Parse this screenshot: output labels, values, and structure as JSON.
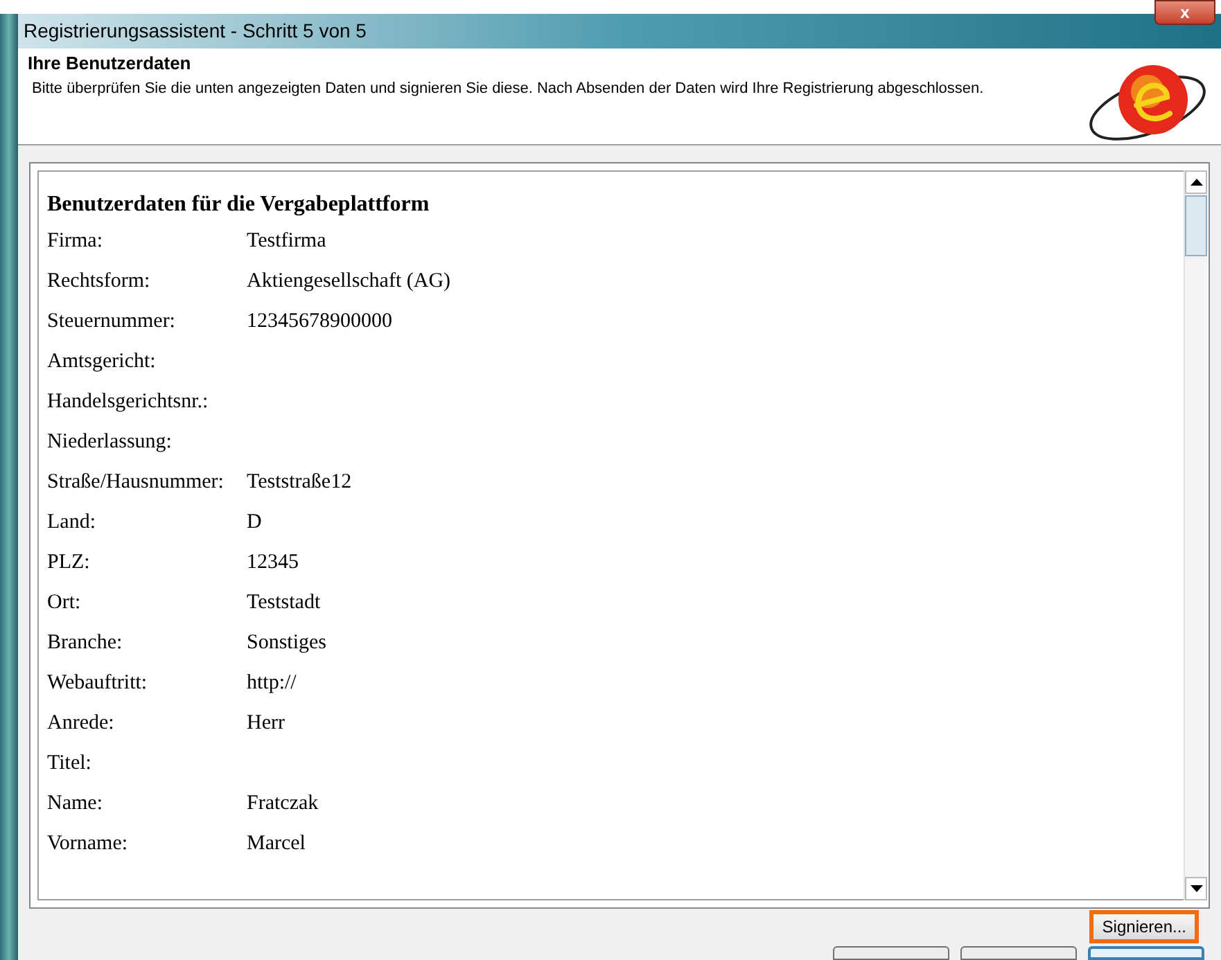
{
  "window": {
    "title": "Registrierungsassistent - Schritt 5 von 5",
    "close_label": "x"
  },
  "header": {
    "title": "Ihre Benutzerdaten",
    "description": "Bitte überprüfen Sie die unten angezeigten Daten und signieren Sie diese. Nach Absenden der Daten wird Ihre Registrierung abgeschlossen."
  },
  "document": {
    "heading": "Benutzerdaten für die Vergabeplattform",
    "rows": [
      {
        "label": "Firma:",
        "value": "Testfirma"
      },
      {
        "label": "Rechtsform:",
        "value": "Aktiengesellschaft (AG)"
      },
      {
        "label": "Steuernummer:",
        "value": "12345678900000"
      },
      {
        "label": "Amtsgericht:",
        "value": ""
      },
      {
        "label": "Handelsgerichtsnr.:",
        "value": ""
      },
      {
        "label": "Niederlassung:",
        "value": ""
      },
      {
        "label": "Straße/Hausnummer:",
        "value": "Teststraße12"
      },
      {
        "label": "Land:",
        "value": "D"
      },
      {
        "label": "PLZ:",
        "value": "12345"
      },
      {
        "label": "Ort:",
        "value": "Teststadt"
      },
      {
        "label": "Branche:",
        "value": "Sonstiges"
      },
      {
        "label": "Webauftritt:",
        "value": "http://"
      },
      {
        "label": "Anrede:",
        "value": "Herr"
      },
      {
        "label": "Titel:",
        "value": ""
      },
      {
        "label": "Name:",
        "value": "Fratczak"
      },
      {
        "label": "Vorname:",
        "value": "Marcel"
      }
    ]
  },
  "sign_button": {
    "label": "Signieren...",
    "highlighted": true
  }
}
